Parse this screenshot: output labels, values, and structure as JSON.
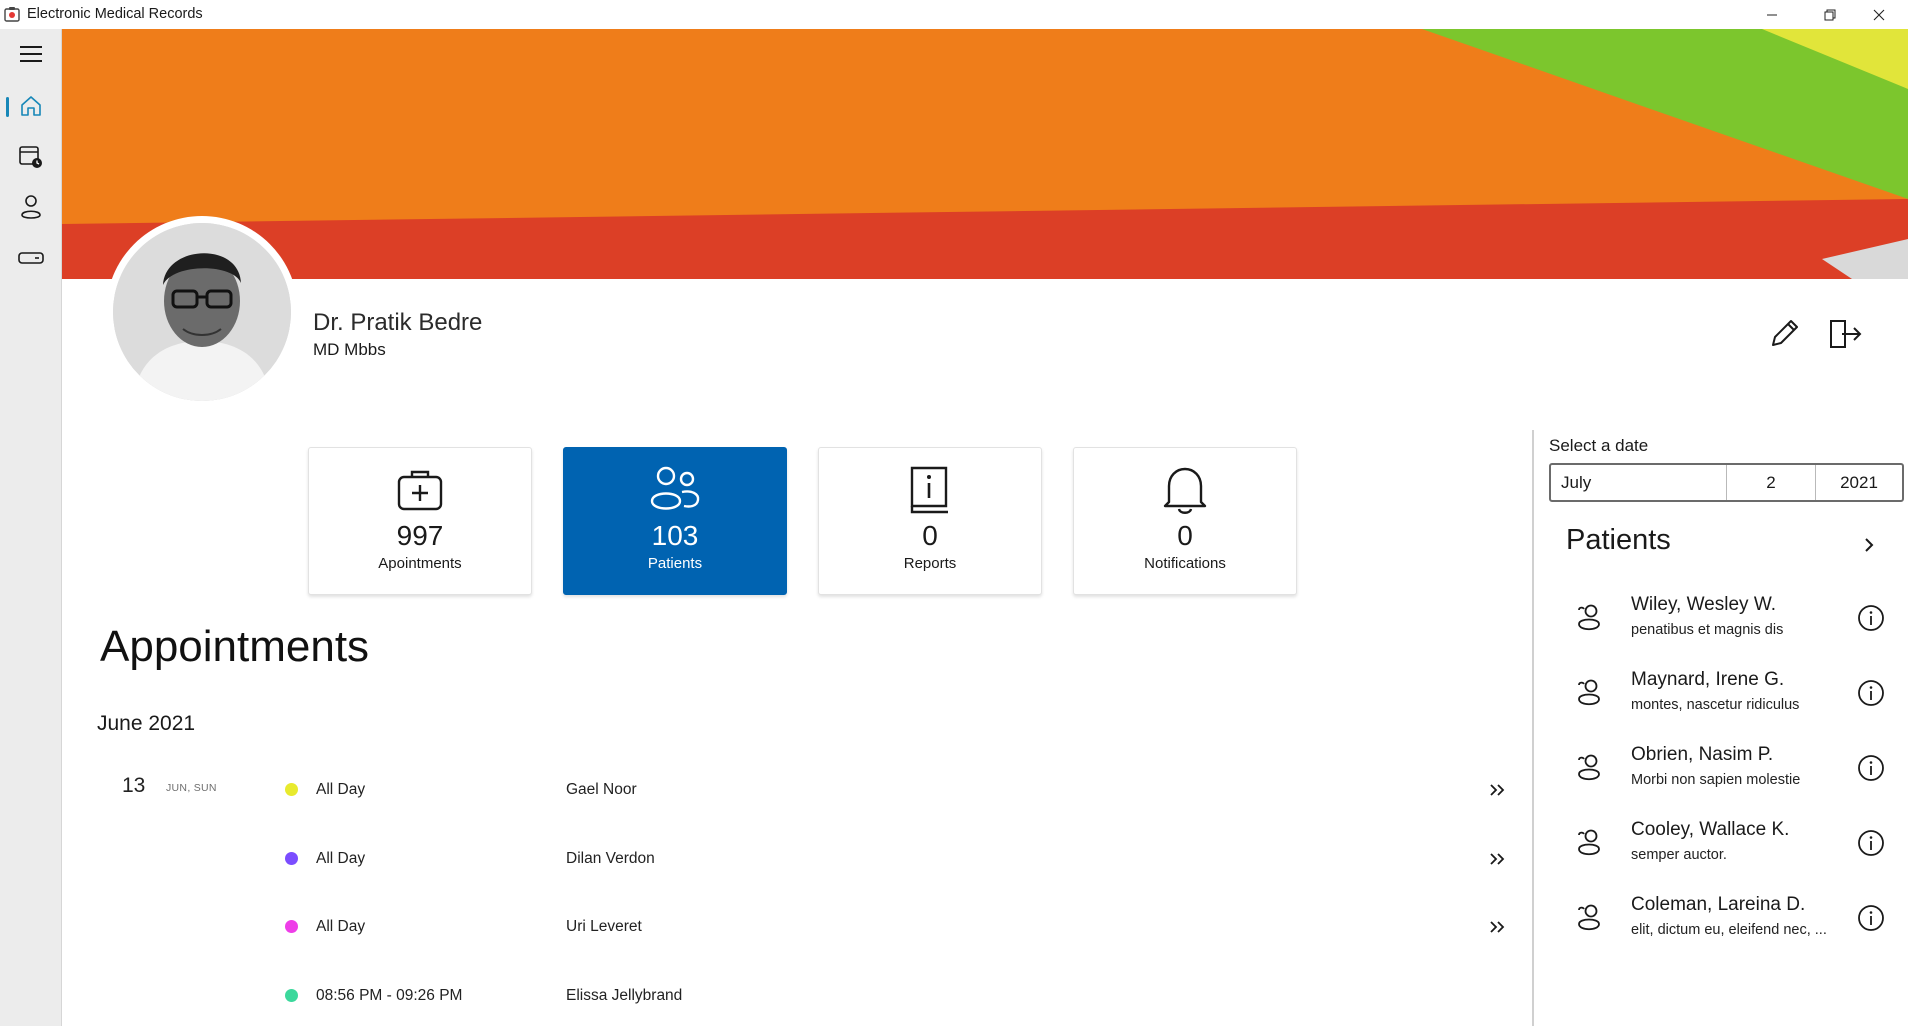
{
  "window": {
    "title": "Electronic Medical Records"
  },
  "colors": {
    "accent": "#0063b1",
    "rail_active": "#1787b8"
  },
  "profile": {
    "name": "Dr. Pratik Bedre",
    "degree": "MD Mbbs"
  },
  "stats": [
    {
      "icon": "medical-kit-icon",
      "value": "997",
      "label": "Apointments"
    },
    {
      "icon": "people-icon",
      "value": "103",
      "label": "Patients"
    },
    {
      "icon": "report-book-icon",
      "value": "0",
      "label": "Reports"
    },
    {
      "icon": "bell-icon",
      "value": "0",
      "label": "Notifications"
    }
  ],
  "appointments": {
    "heading": "Appointments",
    "month": "June 2021",
    "day_number": "13",
    "day_label": "JUN, SUN",
    "items": [
      {
        "time": "All Day",
        "name": "Gael Noor",
        "color": "#e8ea2e"
      },
      {
        "time": "All Day",
        "name": "Dilan Verdon",
        "color": "#7b4dff"
      },
      {
        "time": "All Day",
        "name": "Uri Leveret",
        "color": "#ee3ee8"
      },
      {
        "time": "08:56 PM - 09:26 PM",
        "name": "Elissa Jellybrand",
        "color": "#3cd89c"
      }
    ]
  },
  "date_picker": {
    "caption": "Select a date",
    "month": "July",
    "day": "2",
    "year": "2021"
  },
  "patients": {
    "title": "Patients",
    "items": [
      {
        "name": "Wiley, Wesley W.",
        "note": "penatibus et magnis dis"
      },
      {
        "name": "Maynard, Irene G.",
        "note": "montes, nascetur ridiculus"
      },
      {
        "name": "Obrien, Nasim P.",
        "note": "Morbi non sapien molestie"
      },
      {
        "name": "Cooley, Wallace K.",
        "note": "semper auctor."
      },
      {
        "name": "Coleman, Lareina D.",
        "note": "elit, dictum eu, eleifend nec, ..."
      }
    ]
  }
}
